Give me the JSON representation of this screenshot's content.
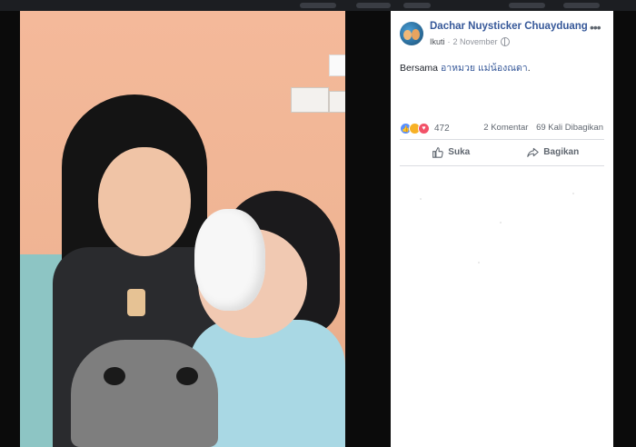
{
  "post": {
    "author": "Dachar Nuysticker Chuayduang",
    "follow_label": "Ikuti",
    "separator": "·",
    "date": "2 November",
    "privacy_icon": "globe-icon",
    "more_label": "•••",
    "caption": {
      "prefix": "Bersama",
      "mention": "อาหมวย แม่น้องณดา",
      "suffix": "."
    },
    "reactions": {
      "icons": [
        "like-icon",
        "sad-icon",
        "love-icon"
      ],
      "count": "472"
    },
    "comments": "2 Komentar",
    "shares": "69 Kali Dibagikan",
    "actions": {
      "like_label": "Suka",
      "share_label": "Bagikan"
    }
  },
  "colors": {
    "link": "#365899",
    "meta": "#90949c",
    "backdrop": "#0b0b0b",
    "like": "#5890ff",
    "love": "#f25268",
    "sad": "#f7b125"
  }
}
